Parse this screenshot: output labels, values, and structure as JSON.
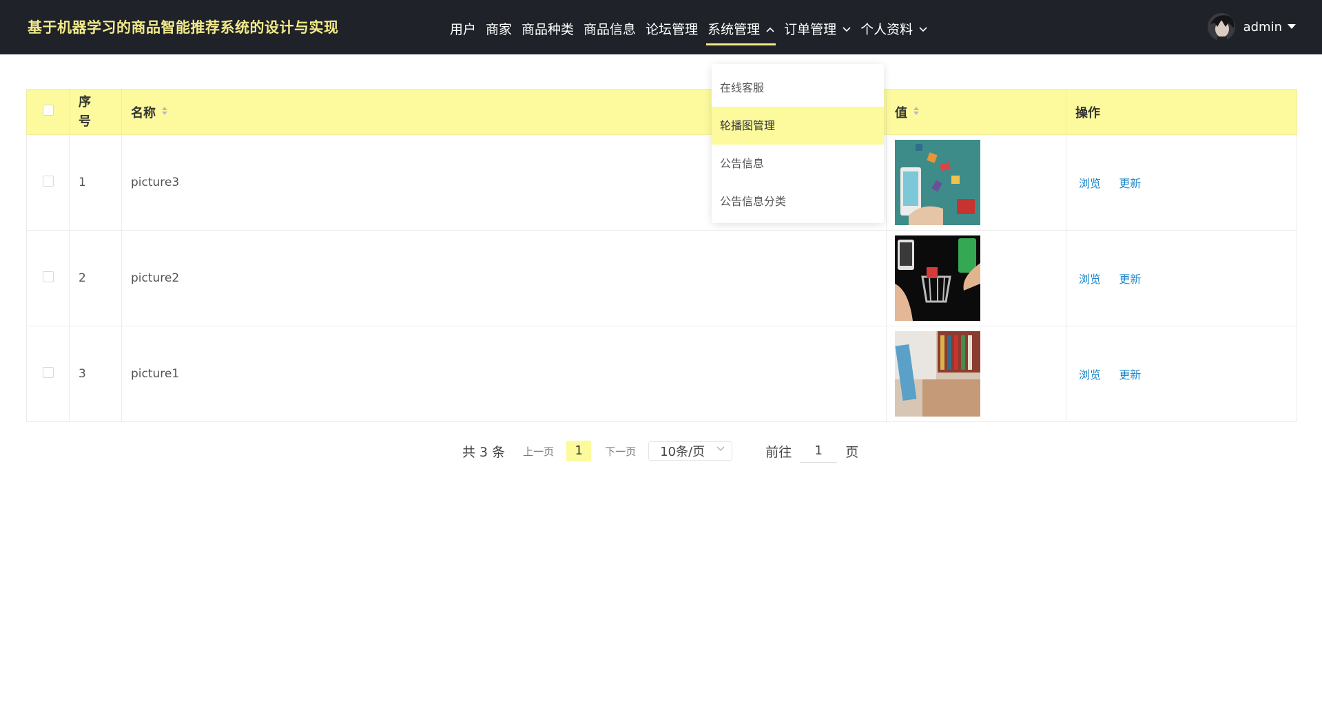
{
  "app": {
    "title": "基于机器学习的商品智能推荐系统的设计与实现"
  },
  "nav": {
    "items": [
      {
        "label": "用户"
      },
      {
        "label": "商家"
      },
      {
        "label": "商品种类"
      },
      {
        "label": "商品信息"
      },
      {
        "label": "论坛管理"
      },
      {
        "label": "系统管理",
        "active": true,
        "expanded": true
      },
      {
        "label": "订单管理"
      },
      {
        "label": "个人资料"
      }
    ]
  },
  "user": {
    "name": "admin"
  },
  "dropdown": {
    "items": [
      {
        "label": "在线客服"
      },
      {
        "label": "轮播图管理",
        "highlighted": true
      },
      {
        "label": "公告信息"
      },
      {
        "label": "公告信息分类"
      }
    ]
  },
  "table": {
    "headers": {
      "index": "序号",
      "name": "名称",
      "value": "值",
      "ops": "操作"
    },
    "rows": [
      {
        "index": "1",
        "name": "picture3",
        "view": "浏览",
        "update": "更新"
      },
      {
        "index": "2",
        "name": "picture2",
        "view": "浏览",
        "update": "更新"
      },
      {
        "index": "3",
        "name": "picture1",
        "view": "浏览",
        "update": "更新"
      }
    ]
  },
  "pagination": {
    "total": "共 3 条",
    "prev": "上一页",
    "current": "1",
    "next": "下一页",
    "page_size": "10条/页",
    "goto_label": "前往",
    "goto_value": "1",
    "page_suffix": "页"
  },
  "colors": {
    "topbar": "#1f2228",
    "accent": "#fcfa9c",
    "title": "#f3ea8a",
    "link": "#1e88c8"
  }
}
